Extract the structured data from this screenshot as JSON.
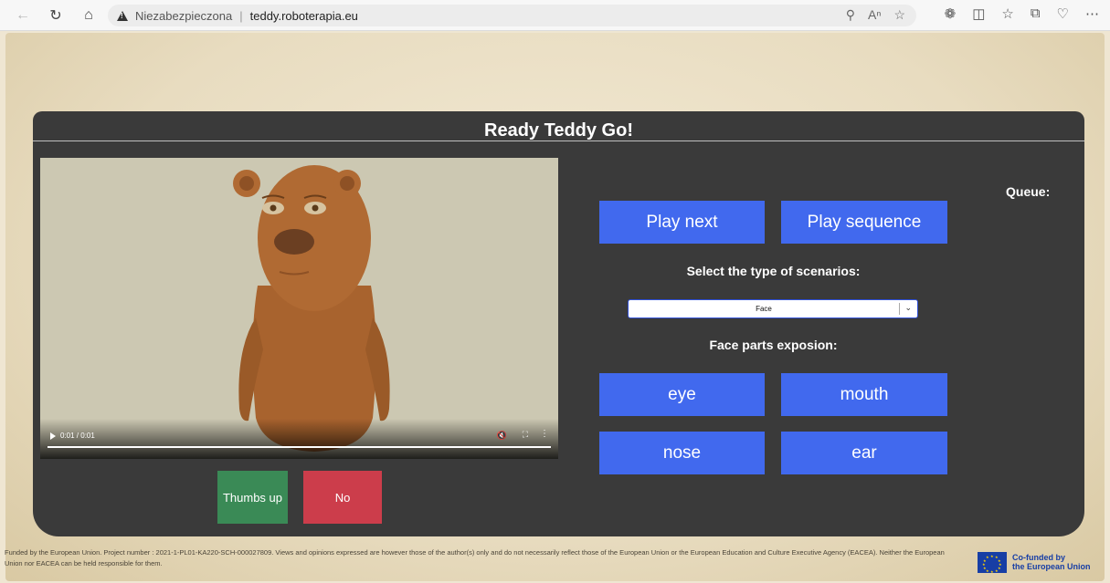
{
  "browser": {
    "insecure_label": "Niezabezpieczona",
    "separator": "|",
    "url": "teddy.roboterapia.eu"
  },
  "app": {
    "title": "Ready Teddy Go!",
    "video": {
      "time": "0:01 / 0:01"
    },
    "feedback": {
      "thumbs_up": "Thumbs up",
      "no": "No"
    },
    "controls": {
      "play_next": "Play next",
      "play_sequence": "Play sequence",
      "scenario_label": "Select the type of scenarios:",
      "scenario_value": "Face",
      "exposure_label": "Face parts exposion:",
      "parts": [
        "eye",
        "mouth",
        "nose",
        "ear"
      ]
    },
    "queue_label": "Queue:"
  },
  "footer": {
    "disclaimer": "Funded by the European Union. Project number : 2021-1-PL01-KA220-SCH-000027809. Views and opinions expressed are however those of the author(s) only and do not necessarily reflect those of the European Union or the European Education and Culture Executive Agency (EACEA). Neither the European Union nor EACEA can be held responsible for them.",
    "eu_line1": "Co-funded by",
    "eu_line2": "the European Union"
  },
  "colors": {
    "panel": "#3a3a3a",
    "button_blue": "#4169ee",
    "thumbs_green": "#3a8a56",
    "no_red": "#cc3d4b"
  }
}
